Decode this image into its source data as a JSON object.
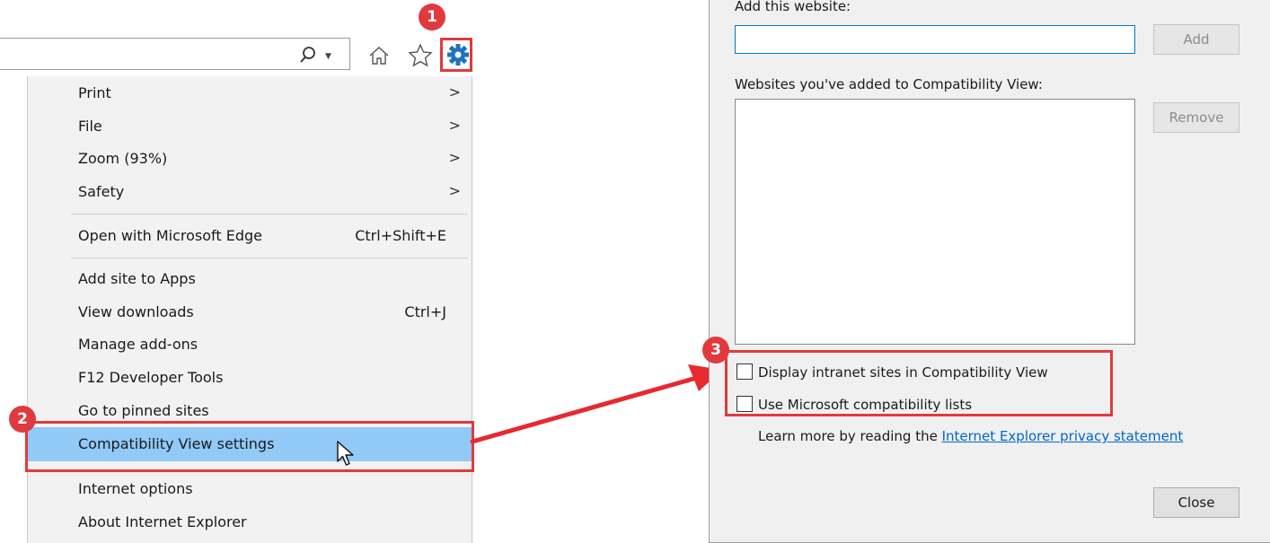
{
  "colors": {
    "accent_red": "#e03a3e",
    "highlight": "#91c9f7",
    "link": "#0066cc",
    "gear": "#1e73be"
  },
  "toolbar": {
    "search_icon": "search-icon",
    "home_icon": "home-icon",
    "favorites_icon": "star-icon",
    "tools_icon": "gear-icon"
  },
  "badges": {
    "one": "1",
    "two": "2",
    "three": "3"
  },
  "menu": {
    "items": [
      {
        "label": "Print",
        "shortcut": "",
        "submenu": true
      },
      {
        "label": "File",
        "shortcut": "",
        "submenu": true
      },
      {
        "label": "Zoom (93%)",
        "shortcut": "",
        "submenu": true
      },
      {
        "label": "Safety",
        "shortcut": "",
        "submenu": true
      },
      {
        "label": "Open with Microsoft Edge",
        "shortcut": "Ctrl+Shift+E",
        "submenu": false
      },
      {
        "label": "Add site to Apps",
        "shortcut": "",
        "submenu": false
      },
      {
        "label": "View downloads",
        "shortcut": "Ctrl+J",
        "submenu": false
      },
      {
        "label": "Manage add-ons",
        "shortcut": "",
        "submenu": false
      },
      {
        "label": "F12 Developer Tools",
        "shortcut": "",
        "submenu": false
      },
      {
        "label": "Go to pinned sites",
        "shortcut": "",
        "submenu": false
      },
      {
        "label": "Compatibility View settings",
        "shortcut": "",
        "submenu": false
      },
      {
        "label": "Internet options",
        "shortcut": "",
        "submenu": false
      },
      {
        "label": "About Internet Explorer",
        "shortcut": "",
        "submenu": false
      }
    ],
    "submenu_arrow": ">"
  },
  "dialog": {
    "add_label": "Add this website:",
    "add_value": "",
    "add_button": "Add",
    "list_label": "Websites you've added to Compatibility View:",
    "remove_button": "Remove",
    "checkbox_intranet": "Display intranet sites in Compatibility View",
    "checkbox_ms_lists": "Use Microsoft compatibility lists",
    "intranet_checked": false,
    "ms_lists_checked": false,
    "learn_more_prefix": "Learn more by reading the ",
    "learn_more_link": "Internet Explorer privacy statement",
    "close_button": "Close"
  }
}
